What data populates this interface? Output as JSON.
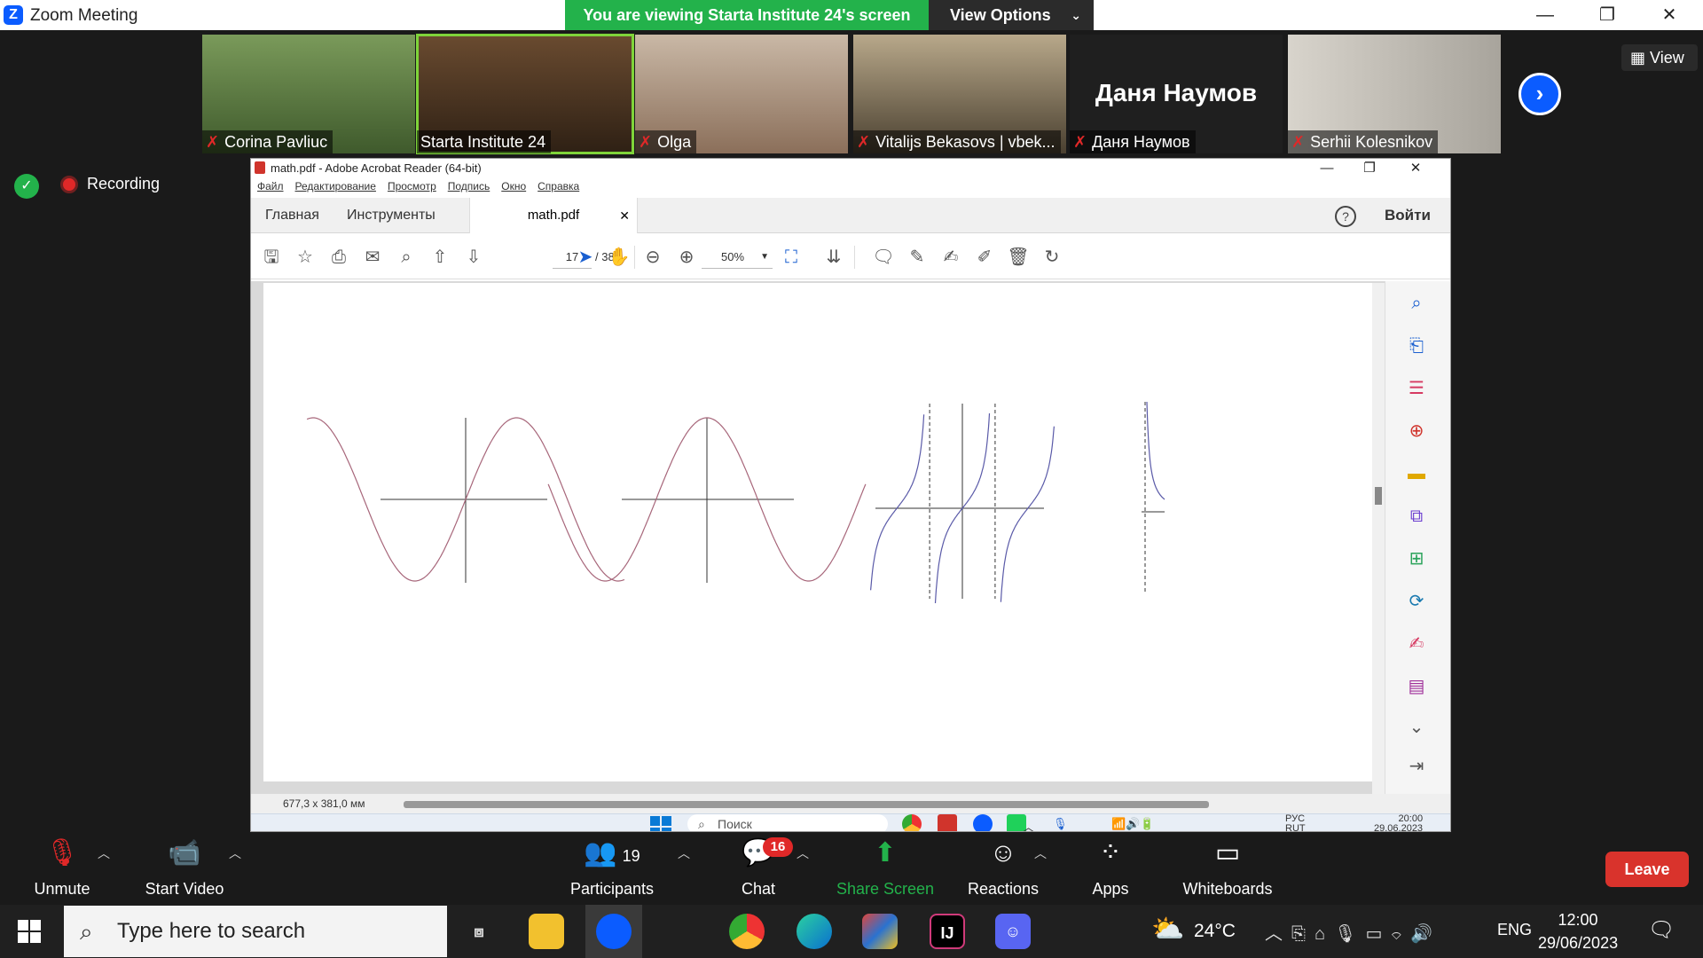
{
  "zoom": {
    "window_title": "Zoom Meeting",
    "share_banner": "You are viewing Starta Institute 24's screen",
    "view_options": "View Options",
    "view_label": "View",
    "recording_label": "Recording",
    "participants_tiles": [
      {
        "name": "Corina Pavliuc",
        "muted": true
      },
      {
        "name": "Starta Institute 24",
        "muted": false,
        "active": true
      },
      {
        "name": "Olga",
        "muted": true
      },
      {
        "name": "Vitalijs Bekasovs | vbek...",
        "muted": true
      },
      {
        "name": "Даня Наумов",
        "muted": true,
        "display_name_large": "Даня Наумов"
      },
      {
        "name": "Serhii Kolesnikov",
        "muted": true
      }
    ],
    "controls": {
      "unmute": "Unmute",
      "start_video": "Start Video",
      "participants": "Participants",
      "participants_count": "19",
      "chat": "Chat",
      "chat_badge": "16",
      "share_screen": "Share Screen",
      "reactions": "Reactions",
      "apps": "Apps",
      "whiteboards": "Whiteboards",
      "leave": "Leave"
    }
  },
  "acrobat": {
    "title": "math.pdf - Adobe Acrobat Reader (64-bit)",
    "menu": [
      "Файл",
      "Редактирование",
      "Просмотр",
      "Подпись",
      "Окно",
      "Справка"
    ],
    "tab_home": "Главная",
    "tab_tools": "Инструменты",
    "tab_file": "math.pdf",
    "login": "Войти",
    "page_current": "17",
    "page_total": "/ 38",
    "zoom": "50%",
    "dimensions": "677,3 x 381,0 мм"
  },
  "remote_taskbar": {
    "search_placeholder": "Поиск",
    "lang_top": "РУС",
    "lang_bottom": "RUT",
    "time": "20:00",
    "date": "29.06.2023"
  },
  "windows_taskbar": {
    "search_placeholder": "Type here to search",
    "temperature": "24°C",
    "language": "ENG",
    "time": "12:00",
    "date": "29/06/2023"
  },
  "colors": {
    "zoom_green": "#23b24b",
    "zoom_blue": "#0b5cff",
    "leave_red": "#d9332c",
    "active_speaker": "#7fd43a",
    "sine_curve": "#a7667a",
    "tangent_curve": "#5a5aa8"
  }
}
